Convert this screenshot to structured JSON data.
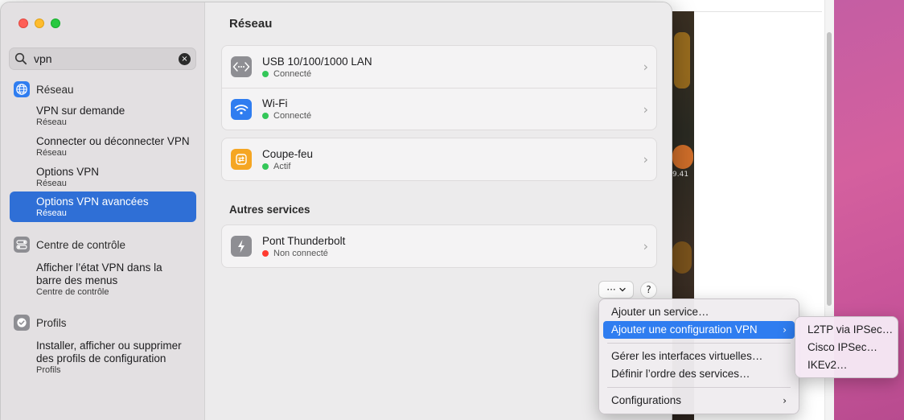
{
  "search": {
    "value": "vpn",
    "clear_glyph": "×"
  },
  "sidebar": {
    "categories": [
      {
        "label": "Réseau",
        "icon": "globe-icon"
      },
      {
        "label": "Centre de contrôle",
        "icon": "control-center-icon"
      },
      {
        "label": "Profils",
        "icon": "checkmark-seal-icon"
      }
    ],
    "items": [
      {
        "title": "VPN sur demande",
        "sub": "Réseau"
      },
      {
        "title": "Connecter ou déconnecter VPN",
        "sub": "Réseau"
      },
      {
        "title": "Options VPN",
        "sub": "Réseau"
      },
      {
        "title": "Options VPN avancées",
        "sub": "Réseau",
        "selected": true
      },
      {
        "title1": "Afficher l’état VPN dans la",
        "title2": "barre des menus",
        "sub": "Centre de contrôle"
      },
      {
        "title1": "Installer, afficher ou supprimer",
        "title2": "des profils de configuration",
        "sub": "Profils"
      }
    ]
  },
  "content": {
    "title": "Réseau",
    "services": [
      {
        "name": "USB 10/100/1000 LAN",
        "status": "Connecté",
        "status_color": "#34c759",
        "icon": "ethernet-icon"
      },
      {
        "name": "Wi-Fi",
        "status": "Connecté",
        "status_color": "#34c759",
        "icon": "wifi-icon"
      },
      {
        "name": "Coupe-feu",
        "status": "Actif",
        "status_color": "#34c759",
        "icon": "firewall-icon"
      }
    ],
    "other_title": "Autres services",
    "other_services": [
      {
        "name": "Pont Thunderbolt",
        "status": "Non connecté",
        "status_color": "#ff3b30",
        "icon": "thunderbolt-icon"
      }
    ],
    "more_button": "···",
    "help_button": "?"
  },
  "menu": {
    "items": [
      {
        "label": "Ajouter un service…"
      },
      {
        "label": "Ajouter une configuration VPN",
        "highlighted": true,
        "submenu": true
      },
      {
        "label": "Gérer les interfaces virtuelles…"
      },
      {
        "label": "Définir l’ordre des services…"
      },
      {
        "label": "Configurations",
        "submenu": true
      }
    ],
    "submenu_items": [
      {
        "label": "L2TP via IPSec…"
      },
      {
        "label": "Cisco IPSec…"
      },
      {
        "label": "IKEv2…"
      }
    ]
  },
  "background": {
    "ticker": "9.41"
  },
  "colors": {
    "accent": "#2f6fd6",
    "menu_highlight": "#2f7df0",
    "desktop": "#c45ea3"
  }
}
